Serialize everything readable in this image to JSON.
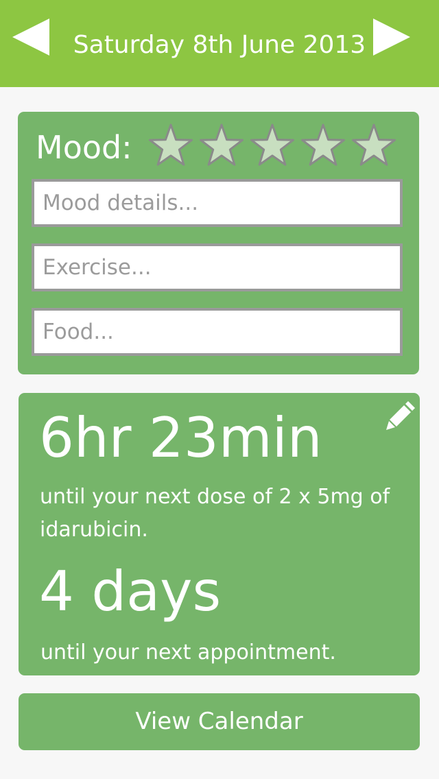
{
  "header": {
    "date": "Saturday 8th June 2013",
    "prev_icon": "left-triangle-arrow",
    "next_icon": "right-triangle-arrow"
  },
  "mood": {
    "label": "Mood:",
    "rating": 0,
    "max_rating": 5,
    "details_placeholder": "Mood details...",
    "exercise_placeholder": "Exercise...",
    "food_placeholder": "Food..."
  },
  "medication": {
    "time_remaining": "6hr 23min",
    "description": "until your next dose of 2 x 5mg of idarubicin.",
    "edit_icon": "pencil-icon"
  },
  "appointment": {
    "time_remaining": "4 days",
    "description": "until your next appointment."
  },
  "actions": {
    "calendar_label": "View Calendar"
  },
  "colors": {
    "header_bg": "#8dc642",
    "card_bg": "#76b56a",
    "star_fill": "#c8dfc0",
    "star_stroke": "#8a8a8a",
    "input_border": "#9a9a9a"
  }
}
